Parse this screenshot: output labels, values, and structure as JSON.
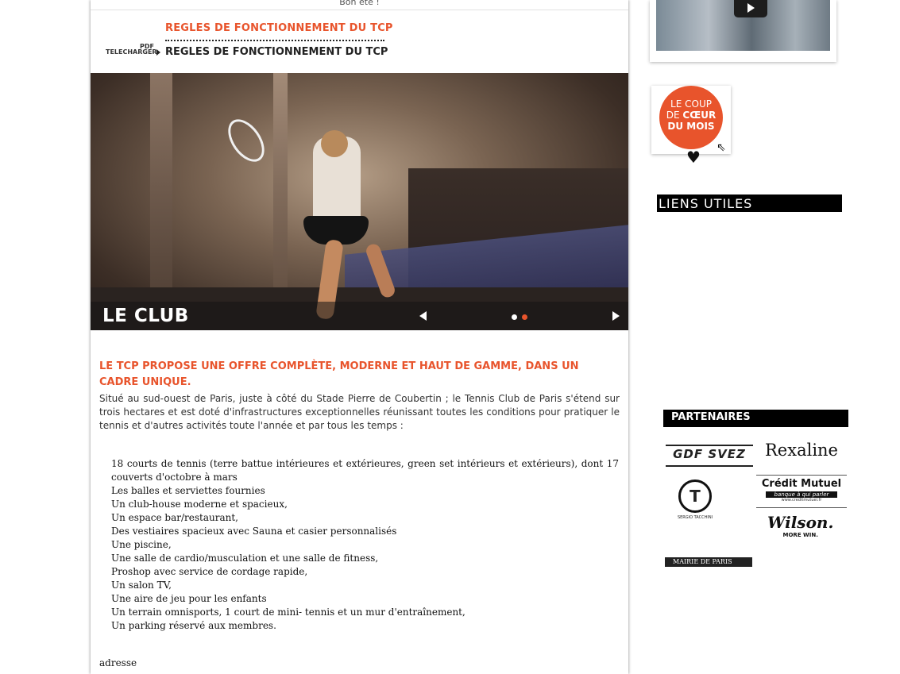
{
  "topbar": {
    "text": "Bon été !"
  },
  "download": {
    "title": "REGLES DE FONCTIONNEMENT DU TCP",
    "pdf_label": "PDF",
    "download_label": "TELECHARGER",
    "link_text": "REGLES DE FONCTIONNEMENT DU TCP"
  },
  "slider": {
    "caption": "LE CLUB",
    "slide_count": 2,
    "active_slide": 2
  },
  "content": {
    "headline": "LE TCP PROPOSE UNE OFFRE COMPLÈTE, MODERNE ET HAUT DE GAMME, DANS UN CADRE UNIQUE.",
    "intro": "Situé au sud-ouest de Paris, juste à côté du Stade Pierre de Coubertin ; le Tennis Club de Paris s'étend sur trois hectares et est doté d'infrastructures exceptionnelles réunissant toutes les conditions pour pratiquer le tennis et d'autres activités toute l'année et par tous les temps :",
    "features": [
      "18 courts de tennis (terre battue intérieures et extérieures, green set intérieurs et extérieurs), dont 17 couverts d'octobre à mars",
      "Les balles et serviettes fournies",
      "Un club-house moderne et spacieux,",
      "Un espace bar/restaurant,",
      "Des vestiaires spacieux avec Sauna et casier personnalisés",
      "Une piscine,",
      "Une salle de cardio/musculation et une salle de fitness,",
      "Proshop avec service de cordage rapide,",
      "Un salon TV,",
      "Une aire de jeu pour les enfants",
      "Un terrain omnisports, 1 court de mini- tennis et un mur d'entraînement,",
      "Un parking réservé aux membres."
    ],
    "address_label": "adresse"
  },
  "sidebar": {
    "coeur": {
      "line1": "LE COUP",
      "line2_pre": "DE ",
      "line2_bold": "CŒUR",
      "line3": "DU MOIS"
    },
    "liens_utiles": "LIENS UTILES",
    "partenaires": "PARTENAIRES",
    "partners": {
      "gdf": "GDF SVEZ",
      "rexaline": "Rexaline",
      "tacchini_mark": "T",
      "tacchini": "SERGIO TACCHINI",
      "credit_title": "Crédit Mutuel",
      "credit_tagline": "banque à qui parler",
      "credit_url": "www.creditmutuel.fr",
      "wilson": "Wilson.",
      "wilson_tagline": "MORE WIN.",
      "mairie": "MAIRIE DE PARIS"
    }
  },
  "colors": {
    "accent": "#e8542c",
    "dark": "#000000"
  }
}
